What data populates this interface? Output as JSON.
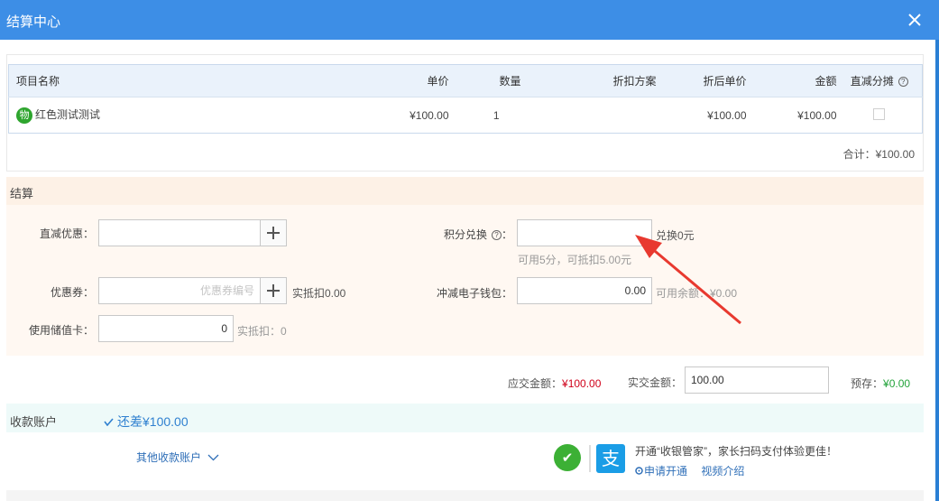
{
  "dialog": {
    "title": "结算中心"
  },
  "items_table": {
    "headers": {
      "name": "项目名称",
      "unit_price": "单价",
      "quantity": "数量",
      "discount_plan": "折扣方案",
      "discounted_price": "折后单价",
      "amount": "金额",
      "direct_split": "直减分摊"
    },
    "rows": [
      {
        "badge": "物",
        "name": "红色测试测试",
        "unit_price": "¥100.00",
        "quantity": "1",
        "discount_plan": "",
        "discounted_price": "¥100.00",
        "amount": "¥100.00",
        "direct_split_checked": false
      }
    ],
    "total": "合计：¥100.00"
  },
  "settlement": {
    "title": "结算",
    "direct_discount": {
      "label": "直减优惠：",
      "value": ""
    },
    "coupon": {
      "label": "优惠券：",
      "placeholder": "优惠券编号",
      "value": "",
      "note": "实抵扣0.00"
    },
    "stored_card": {
      "label": "使用储值卡：",
      "value": "0",
      "note": "实抵扣：0"
    },
    "points": {
      "label": "积分兑换",
      "value": "",
      "note": "兑换0元",
      "hint": "可用5分，可抵扣5.00元"
    },
    "wallet": {
      "label": "冲减电子钱包：",
      "value": "0.00",
      "note": "可用余额：¥0.00"
    }
  },
  "amounts": {
    "due_label": "应交金额：",
    "due_value": "¥100.00",
    "paid_label": "实交金额：",
    "paid_value": "100.00",
    "prestore_label": "预存：",
    "prestore_value": "¥0.00"
  },
  "account": {
    "title": "收款账户",
    "difference": "还差¥100.00",
    "other_accounts": "其他收款账户",
    "promo_text": "开通“收银管家”，家长扫码支付体验更佳！",
    "apply_link": "申请开通",
    "video_link": "视频介绍",
    "wechat_glyph": "✔",
    "alipay_glyph": "支"
  },
  "colors": {
    "titlebar": "#3d8ee6",
    "money_red": "#d0021b",
    "money_green": "#22a33a",
    "link_blue": "#2f6fb8",
    "annotation_arrow": "#e8392f"
  }
}
